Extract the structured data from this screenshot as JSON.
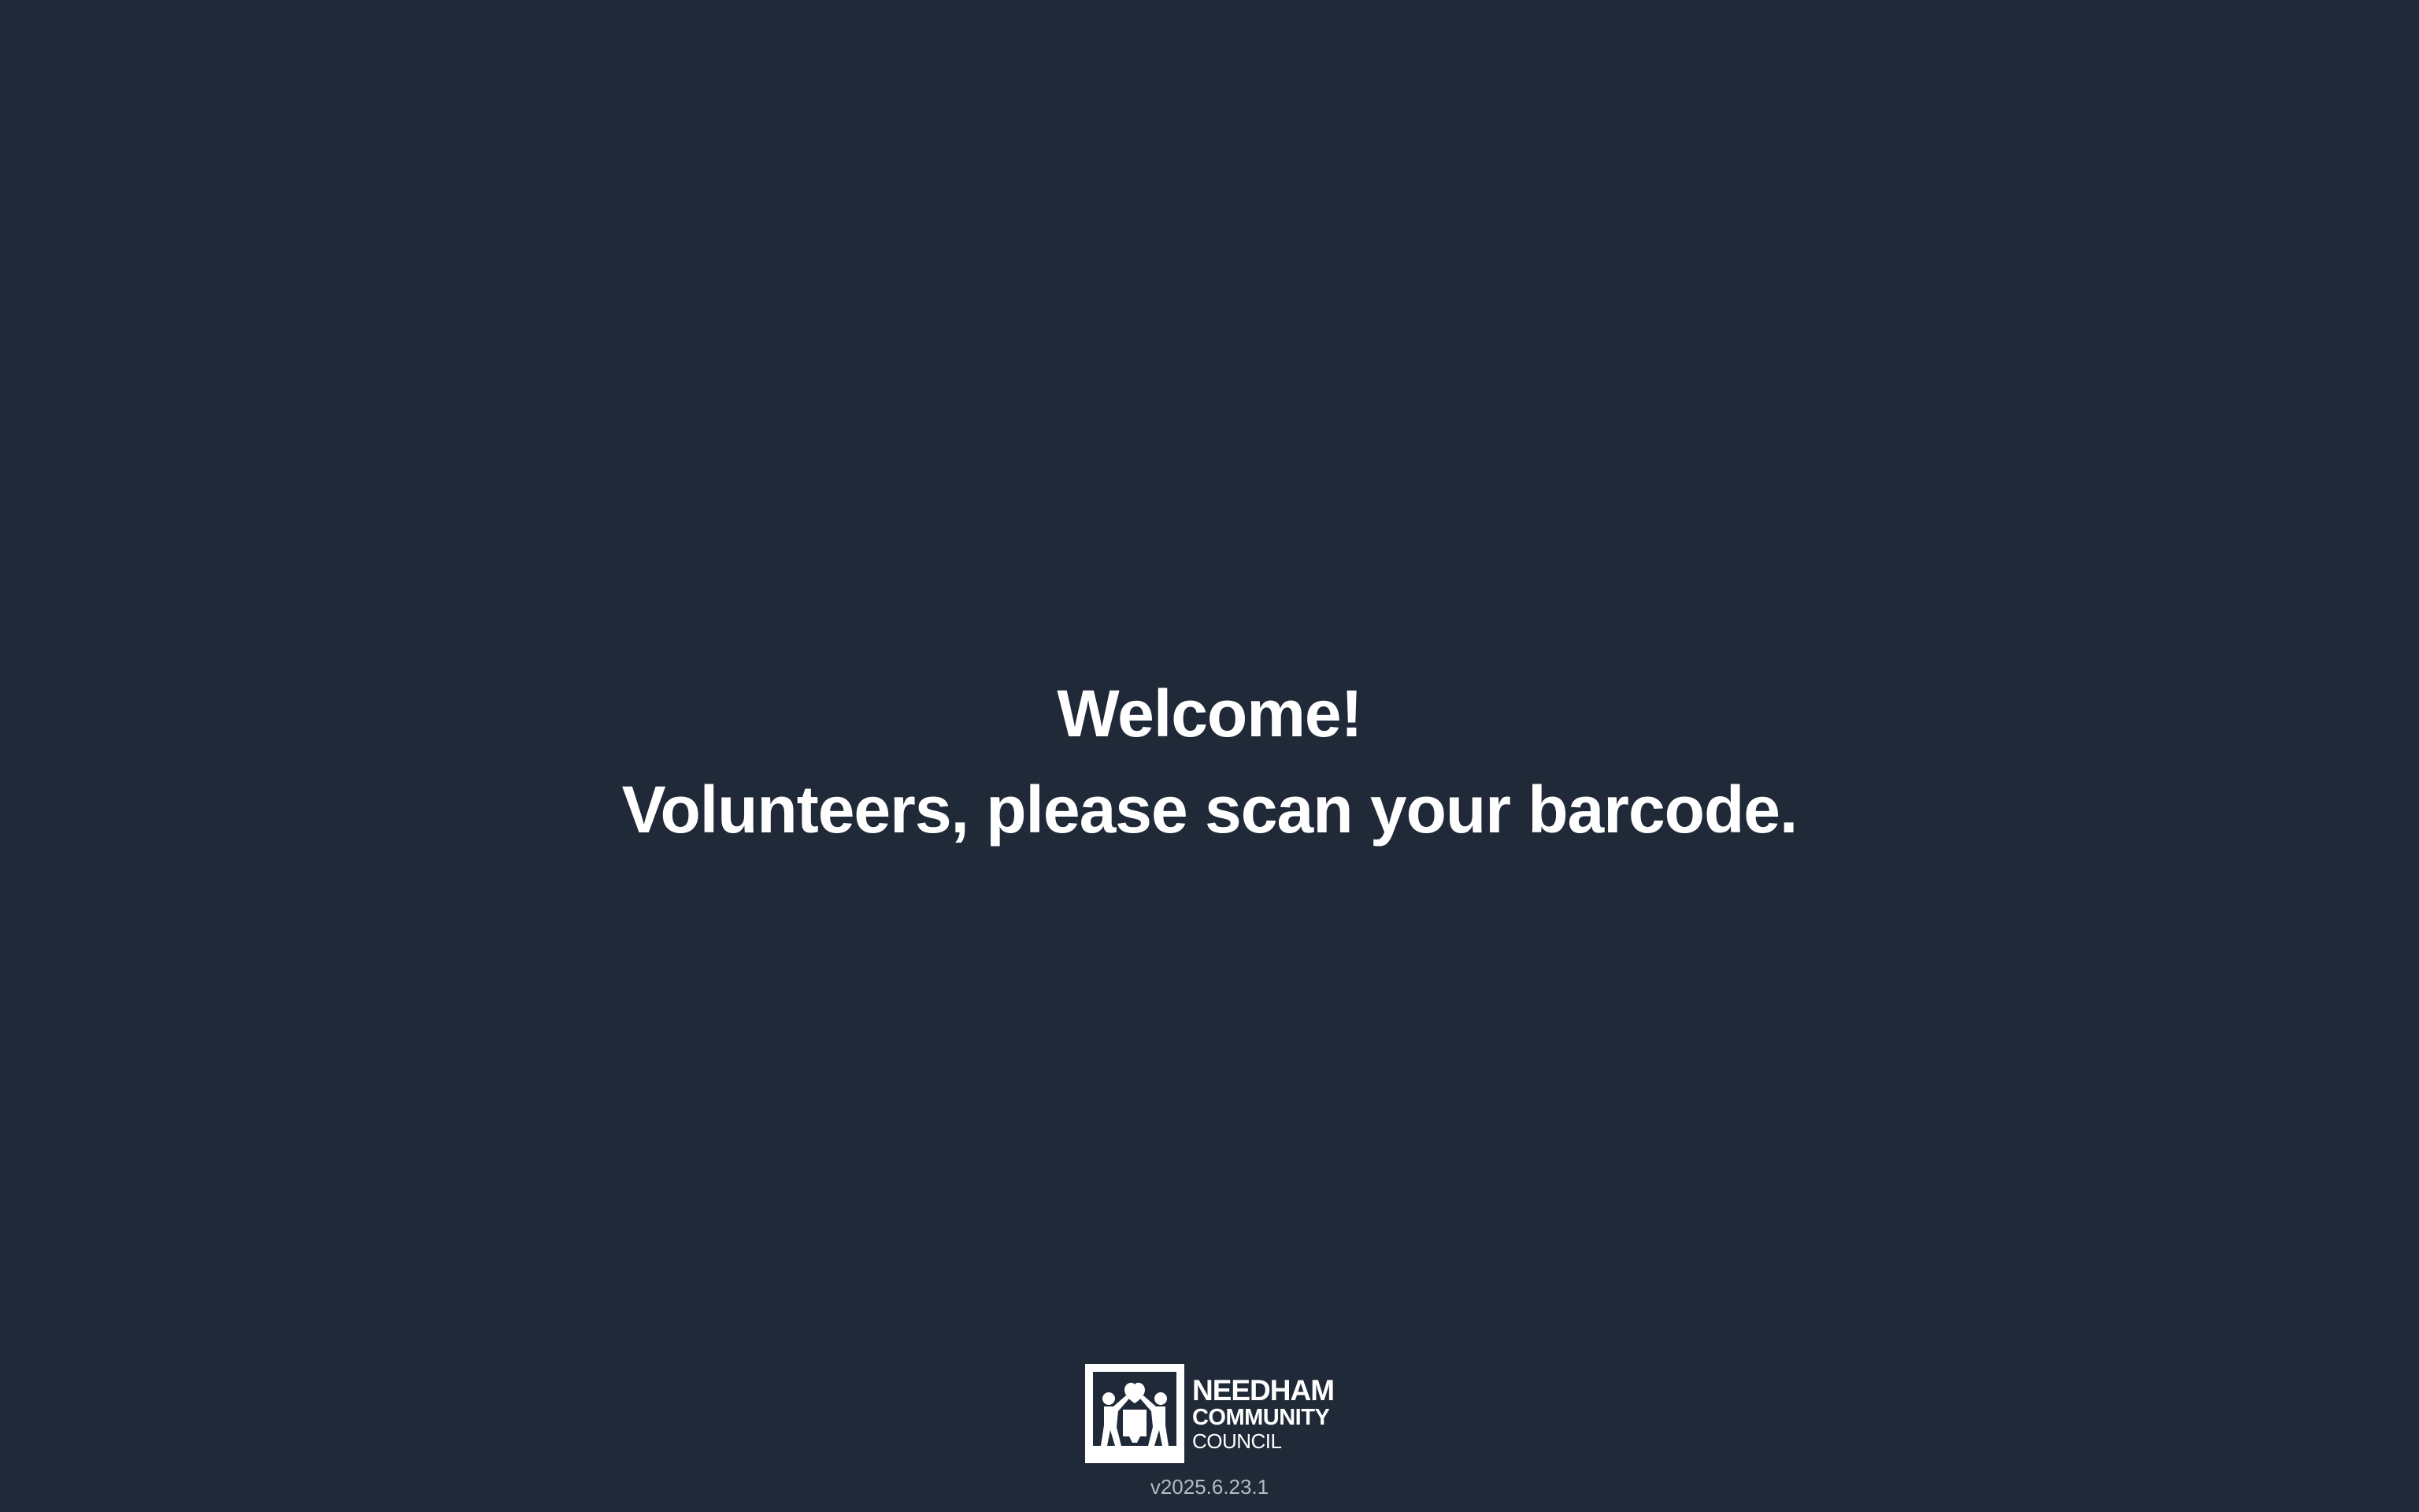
{
  "welcome": {
    "line1": "Welcome!",
    "line2": "Volunteers, please scan your barcode."
  },
  "footer": {
    "logo": {
      "icon": "people-heart-logo-icon",
      "line1": "NEEDHAM",
      "line2": "COMMUNITY",
      "line3": "COUNCIL"
    },
    "version": "v2025.6.23.1"
  },
  "colors": {
    "background": "#202938",
    "text": "#ffffff",
    "muted_text": "#b4bac4"
  }
}
